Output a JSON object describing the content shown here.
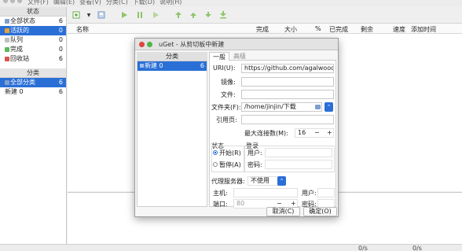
{
  "menubar": {
    "items": [
      "文件(F)",
      "编辑(E)",
      "查看(V)",
      "分类(C)",
      "下载(D)",
      "说明(H)"
    ]
  },
  "sidebar": {
    "status_header": "状态",
    "status_items": [
      {
        "label": "全部状态",
        "count": "6"
      },
      {
        "label": "活跃的",
        "count": "0"
      },
      {
        "label": "队列",
        "count": "0"
      },
      {
        "label": "完成",
        "count": "0"
      },
      {
        "label": "回收站",
        "count": "6"
      }
    ],
    "category_header": "分类",
    "category_items": [
      {
        "label": "全部分类",
        "count": "6"
      },
      {
        "label": "新建 0",
        "count": "6"
      }
    ]
  },
  "table": {
    "columns": [
      "名称",
      "完成",
      "大小",
      "%",
      "已完成",
      "剩余",
      "速度",
      "添加时间"
    ]
  },
  "statusbar": {
    "down": "0/s",
    "up": "0/s"
  },
  "dialog": {
    "title": "uGet - 从剪切板中新建",
    "category_header": "分类",
    "category_item": {
      "label": "新建 0",
      "count": "6"
    },
    "tabs": [
      "一般",
      "高级"
    ],
    "uri_label": "URI(U):",
    "uri_value": "https://github.com/agalwood/M",
    "mirror_label": "镜像:",
    "file_label": "文件:",
    "folder_label": "文件夹(F):",
    "folder_value": "/home/jinjin/下载",
    "referrer_label": "引用页:",
    "max_conn_label": "最大连接数(M):",
    "max_conn_value": "16",
    "minus": "−",
    "plus": "+",
    "state_label": "状态",
    "start_label": "开始(R)",
    "pause_label": "暂停(A)",
    "login_label": "登录",
    "user_label": "用户:",
    "password_label": "密码:",
    "proxy_label": "代理服务器:",
    "proxy_value": "不使用",
    "host_label": "主机:",
    "proxy_user_label": "用户:",
    "port_label": "端口:",
    "port_value": "80",
    "proxy_password_label": "密码:",
    "cancel": "取消(C)",
    "ok": "确定(O)"
  }
}
